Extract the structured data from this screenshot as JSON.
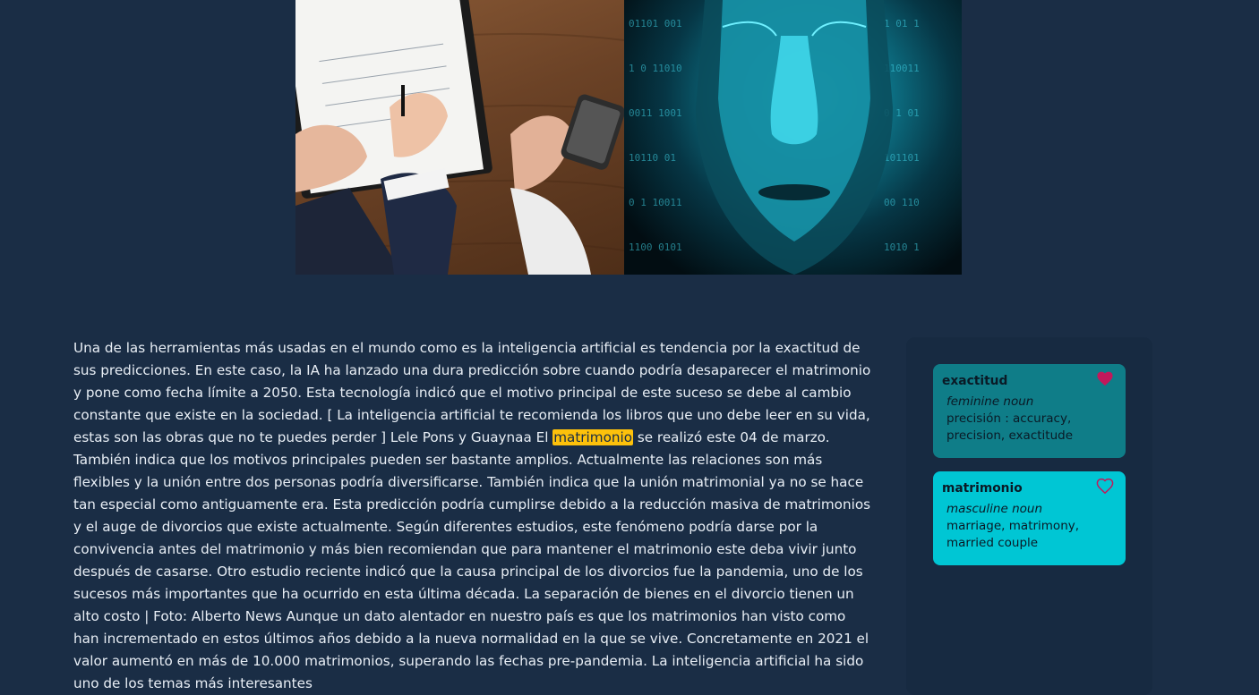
{
  "article": {
    "before_highlight": "Una de las herramientas más usadas en el mundo como es la inteligencia artificial es tendencia por la exactitud de sus predicciones. En este caso, la IA ha lanzado una dura predicción sobre cuando podría desaparecer el matrimonio y pone como fecha límite a 2050. Esta tecnología indicó que el motivo principal de este suceso se debe al cambio constante que existe en la sociedad. [ La inteligencia artificial te recomienda los libros que uno debe leer en su vida, estas son las obras que no te puedes perder ] Lele Pons y Guaynaa El ",
    "highlighted_word": "matrimonio",
    "after_highlight": " se realizó este 04 de marzo. También indica que los motivos principales pueden ser bastante amplios. Actualmente las relaciones son más flexibles y la unión entre dos personas podría diversificarse. También indica que la unión matrimonial ya no se hace tan especial como antiguamente era. Esta predicción podría cumplirse debido a la reducción masiva de matrimonios y el auge de divorcios que existe actualmente. Según diferentes estudios, este fenómeno podría darse por la convivencia antes del matrimonio y más bien recomiendan que para mantener el matrimonio este deba vivir junto después de casarse. Otro estudio reciente indicó que la causa principal de los divorcios fue la pandemia, uno de los sucesos más importantes que ha ocurrido en esta última década. La separación de bienes en el divorcio tienen un alto costo | Foto: Alberto News Aunque un dato alentador en nuestro país es que los matrimonios han visto como han incrementado en estos últimos años debido a la nueva normalidad en la que se vive. Concretamente en 2021 el valor aumentó en más de 10.000 matrimonios, superando las fechas pre-pandemia. La inteligencia artificial ha sido uno de los temas más interesantes"
  },
  "vocab_cards": [
    {
      "word": "exactitud",
      "pos": "feminine noun",
      "definition": "precisión : accuracy, precision, exactitude",
      "favorited": true
    },
    {
      "word": "matrimonio",
      "pos": "masculine noun",
      "definition": "marriage, matrimony, married couple",
      "favorited": false
    }
  ],
  "colors": {
    "background": "#1a2d45",
    "highlight": "#fdc10b",
    "card_active": "#0f7d88",
    "card_current": "#00c6d4",
    "heart_filled": "#c2185b"
  },
  "icons": {
    "favorite_filled": "heart-filled-icon",
    "favorite_outline": "heart-outline-icon"
  }
}
